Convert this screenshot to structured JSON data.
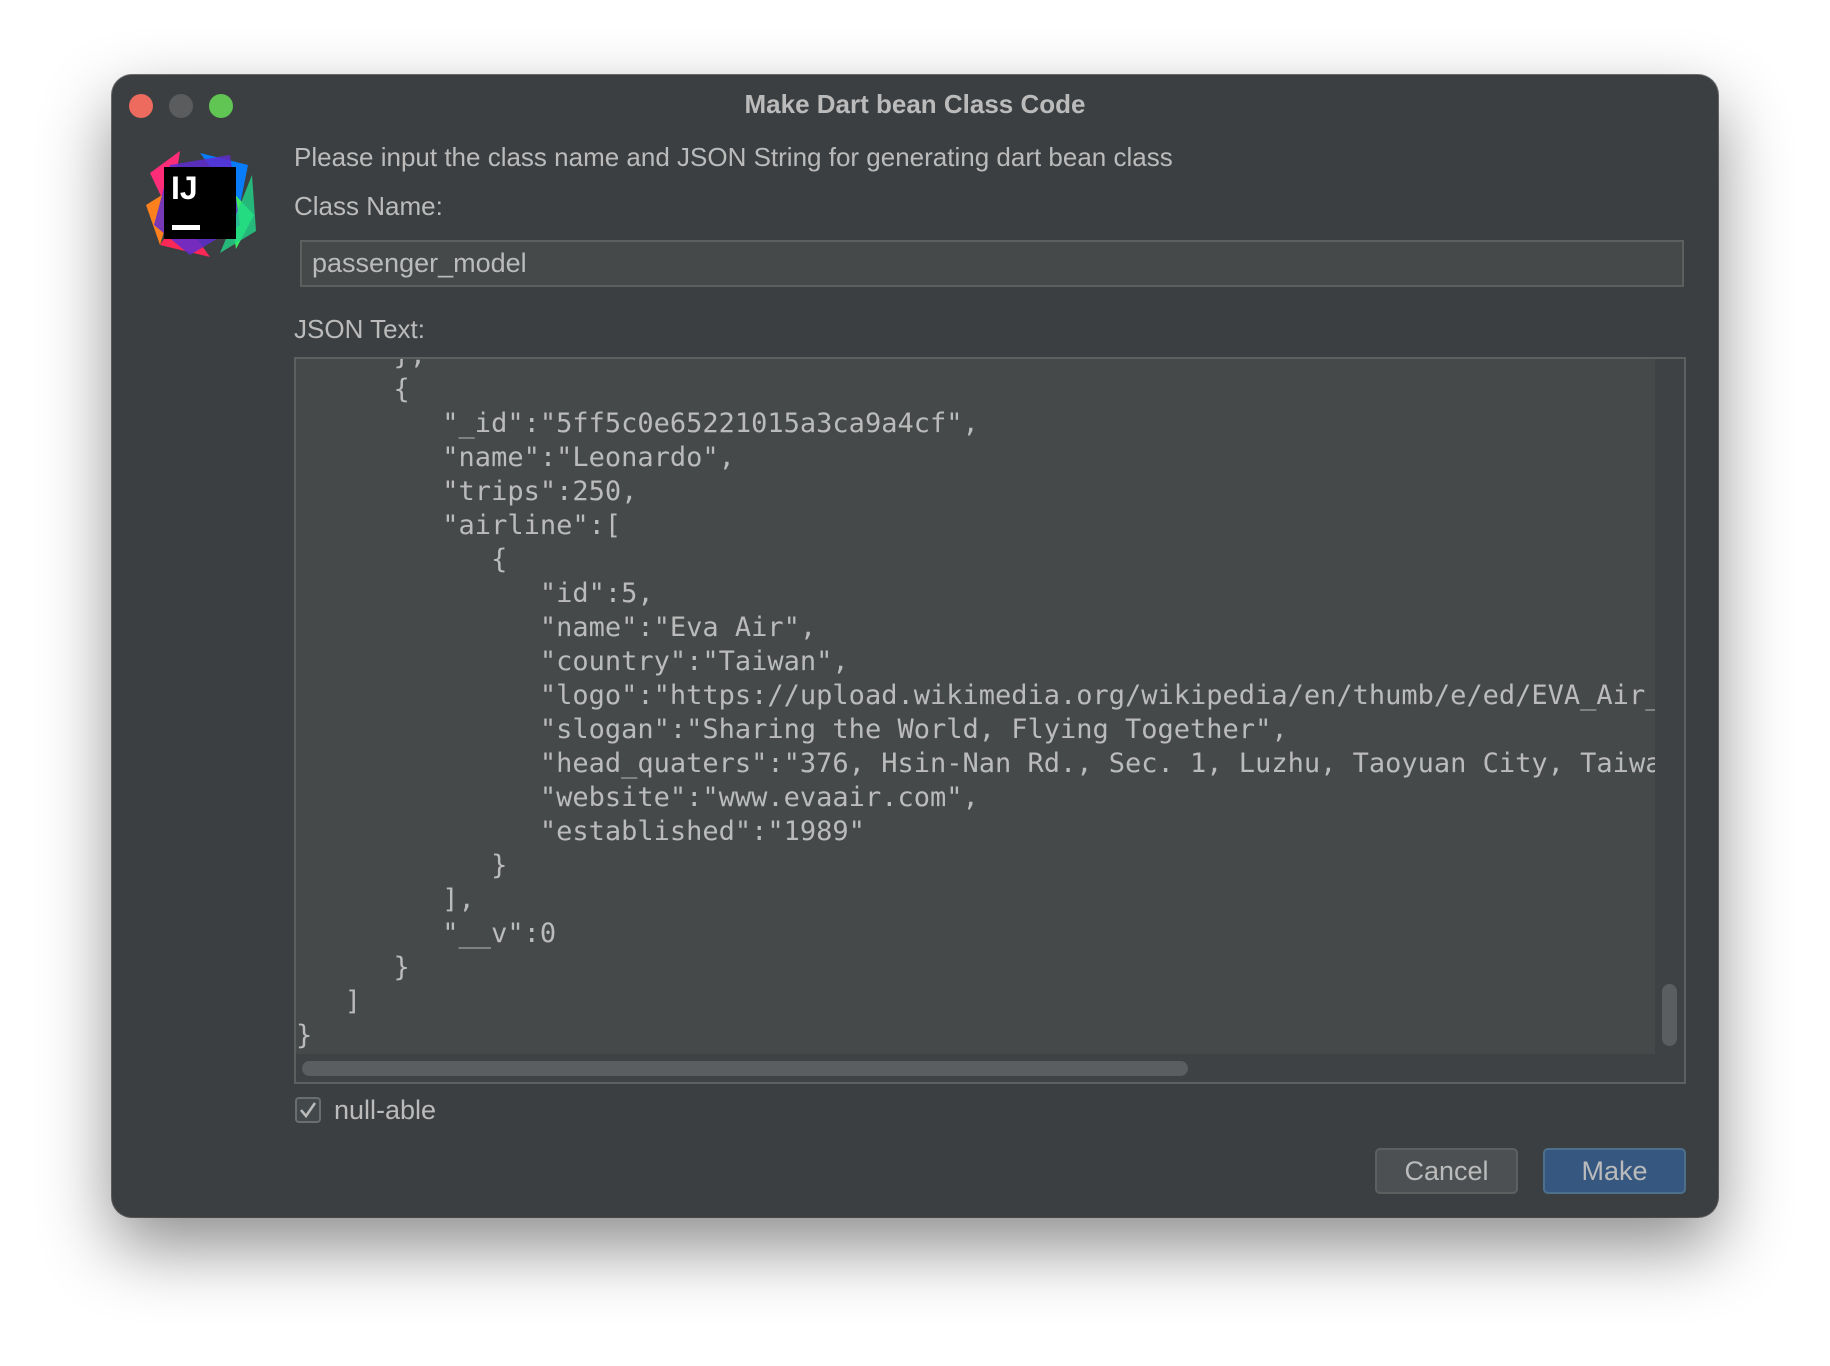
{
  "window": {
    "title": "Make Dart bean Class Code"
  },
  "dialog": {
    "prompt": "Please input the class name and JSON String for generating dart bean class",
    "class_name_label": "Class Name:",
    "class_name_value": "passenger_model",
    "json_label": "JSON Text:",
    "json_text": "      },\n      {\n         \"_id\":\"5ff5c0e65221015a3ca9a4cf\",\n         \"name\":\"Leonardo\",\n         \"trips\":250,\n         \"airline\":[\n            {\n               \"id\":5,\n               \"name\":\"Eva Air\",\n               \"country\":\"Taiwan\",\n               \"logo\":\"https://upload.wikimedia.org/wikipedia/en/thumb/e/ed/EVA_Air_logo\n               \"slogan\":\"Sharing the World, Flying Together\",\n               \"head_quaters\":\"376, Hsin-Nan Rd., Sec. 1, Luzhu, Taoyuan City, Taiwan\",\n               \"website\":\"www.evaair.com\",\n               \"established\":\"1989\"\n            }\n         ],\n         \"__v\":0\n      }\n   ]\n}",
    "nullable_label": "null-able",
    "nullable_checked": true
  },
  "buttons": {
    "cancel_label": "Cancel",
    "make_label": "Make"
  },
  "icons": {
    "app_logo": "intellij-idea-logo",
    "checkbox": "check-icon"
  },
  "colors": {
    "window_bg": "#3c3f41",
    "text": "#bbbbbb",
    "field_bg": "#45494a",
    "primary_button": "#365880",
    "close": "#ed6a5e",
    "zoom": "#61c554"
  }
}
